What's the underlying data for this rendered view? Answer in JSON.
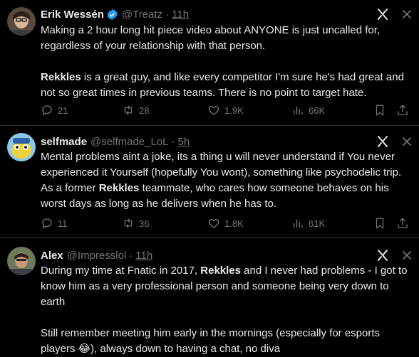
{
  "tweets": [
    {
      "name": "Erik Wessén",
      "verified": true,
      "handle": "@Treatz",
      "dot": "·",
      "time": "11h",
      "paragraphs": [
        [
          {
            "t": "Making a 2 hour long hit piece video about ANYONE is just uncalled for, regardless of your relationship with that person.",
            "b": false
          }
        ],
        [
          {
            "t": "Rekkles",
            "b": true
          },
          {
            "t": " is a great guy, and like every competitor I'm sure he's had great and not so great times in previous teams.  There is no point to target hate.",
            "b": false
          }
        ]
      ],
      "replies": "21",
      "retweets": "28",
      "likes": "1.9K",
      "views": "66K"
    },
    {
      "name": "selfmade",
      "verified": false,
      "handle": "@selfmade_LoL",
      "dot": "·",
      "time": "5h",
      "paragraphs": [
        [
          {
            "t": "Mental problems aint a joke, its a thing u will never understand if You never experienced it Yourself (hopefully You wont), something like psychodelic trip. As a former ",
            "b": false
          },
          {
            "t": "Rekkles",
            "b": true
          },
          {
            "t": " teammate, who cares how someone behaves on his worst days as long as he delivers when he has to.",
            "b": false
          }
        ]
      ],
      "replies": "11",
      "retweets": "36",
      "likes": "1.8K",
      "views": "61K"
    },
    {
      "name": "Alex",
      "verified": false,
      "handle": "@Impresslol",
      "dot": "·",
      "time": "11h",
      "paragraphs": [
        [
          {
            "t": "During my time at Fnatic in 2017, ",
            "b": false
          },
          {
            "t": "Rekkles",
            "b": true
          },
          {
            "t": " and I never had problems - I got to know him as a very professional person and someone being very down to earth",
            "b": false
          }
        ],
        [
          {
            "t": "Still remember meeting him early in the mornings (especially for esports players 😂), always down to having a chat, no diva",
            "b": false
          }
        ]
      ]
    }
  ],
  "colors": {
    "accent": "#1d9bf0",
    "muted": "#71767b",
    "text": "#e7e9ea",
    "border": "#2f3336",
    "bg": "#000000"
  }
}
